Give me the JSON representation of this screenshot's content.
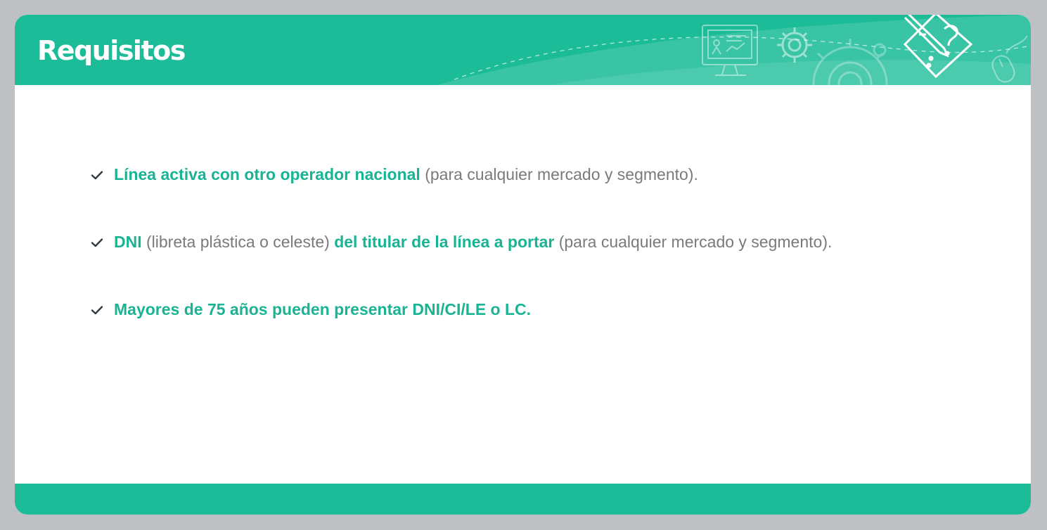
{
  "header": {
    "title": "Requisitos"
  },
  "requirements": [
    {
      "parts": [
        {
          "text": "Línea activa con otro operador nacional",
          "emphasis": true
        },
        {
          "text": " (para cualquier mercado y segmento).",
          "emphasis": false
        }
      ]
    },
    {
      "parts": [
        {
          "text": "DNI",
          "emphasis": true
        },
        {
          "text": " (libreta plástica o celeste) ",
          "emphasis": false
        },
        {
          "text": "del titular de la línea a portar",
          "emphasis": true
        },
        {
          "text": " (para cualquier mercado y segmento).",
          "emphasis": false
        }
      ]
    },
    {
      "parts": [
        {
          "text": "Mayores de 75 años pueden presentar DNI/CI/LE o LC.",
          "emphasis": true
        }
      ]
    }
  ],
  "icons": {
    "bullet": "check-icon",
    "header_decorations": [
      "monitor-presentation-icon",
      "gear-icon",
      "large-gear-icon",
      "pencil-question-icon",
      "mouse-icon"
    ]
  },
  "colors": {
    "brand": "#1dbc99",
    "emphasis_text": "#1ab394",
    "body_text": "#7a7a7a",
    "check": "#2f3a46",
    "background": "#bec1c4"
  }
}
